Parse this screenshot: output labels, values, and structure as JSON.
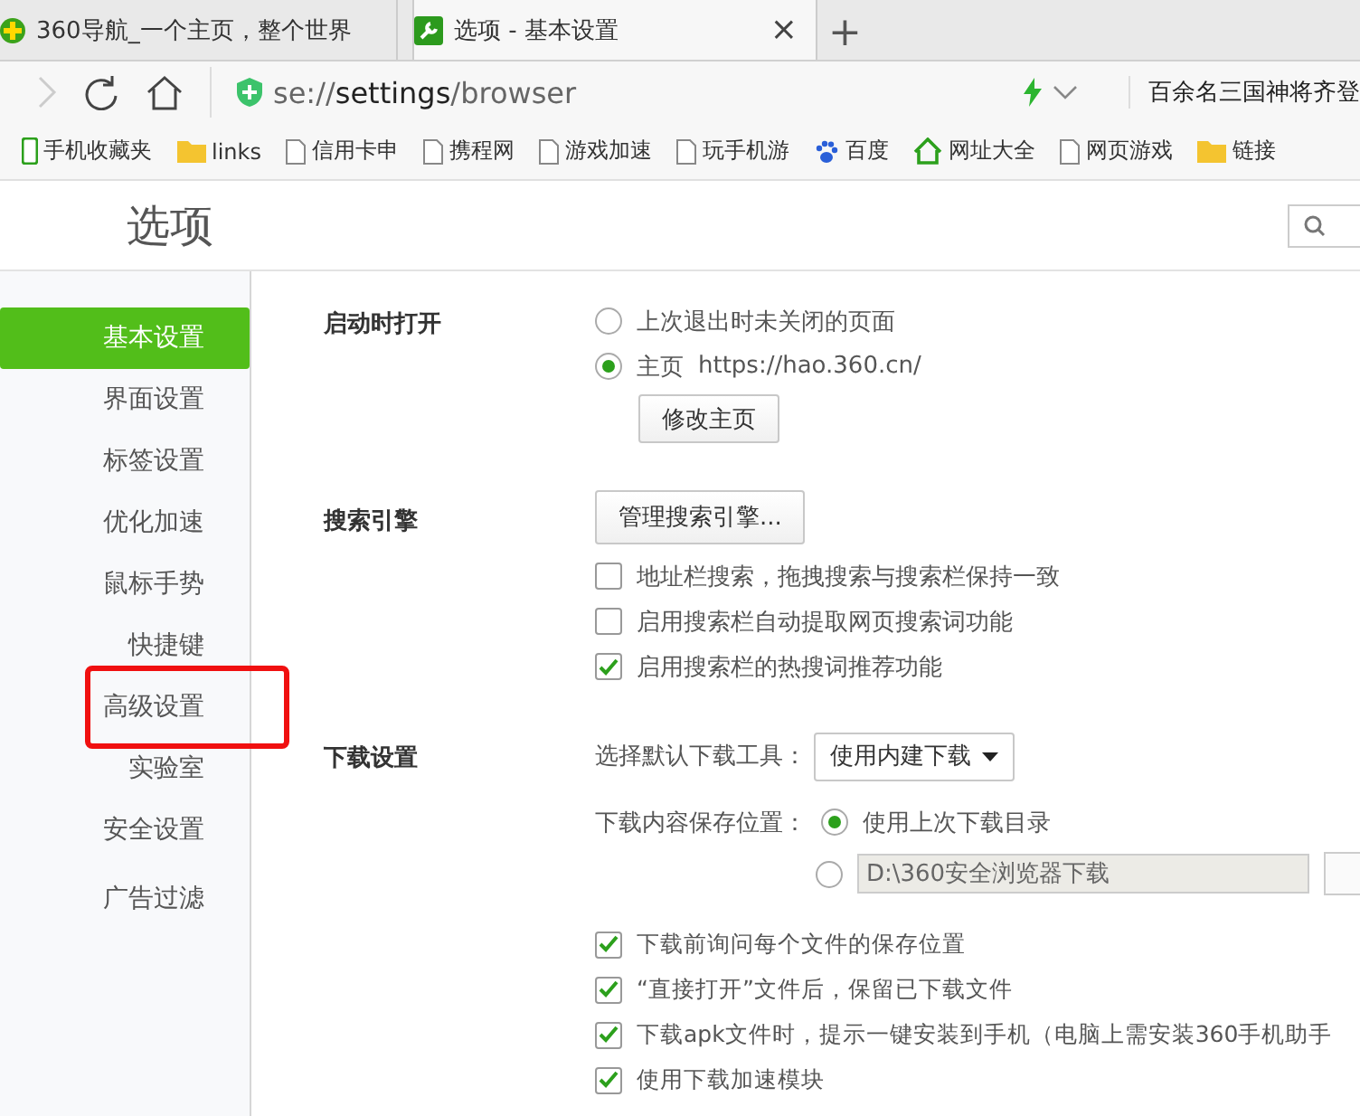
{
  "tabs": [
    {
      "title": "360导航_一个主页，整个世界",
      "selected": false,
      "kind": "plus"
    },
    {
      "title": "选项 - 基本设置",
      "selected": true,
      "kind": "wrench",
      "close": "×"
    }
  ],
  "new_tab": "+",
  "address": {
    "scheme": "se://",
    "host": "settings",
    "path": "/browser",
    "news": "百余名三国神将齐登"
  },
  "bookmarks": [
    {
      "label": "手机收藏夹",
      "kind": "phone"
    },
    {
      "label": "links",
      "kind": "folder"
    },
    {
      "label": "信用卡申",
      "kind": "page"
    },
    {
      "label": "携程网",
      "kind": "page"
    },
    {
      "label": "游戏加速",
      "kind": "page"
    },
    {
      "label": "玩手机游",
      "kind": "page"
    },
    {
      "label": "百度",
      "kind": "paw"
    },
    {
      "label": "网址大全",
      "kind": "house"
    },
    {
      "label": "网页游戏",
      "kind": "page"
    },
    {
      "label": "链接",
      "kind": "folder"
    }
  ],
  "page_title": "选项",
  "sidebar": [
    {
      "label": "基本设置",
      "selected": true,
      "highlighted": false
    },
    {
      "label": "界面设置",
      "selected": false,
      "highlighted": false
    },
    {
      "label": "标签设置",
      "selected": false,
      "highlighted": false
    },
    {
      "label": "优化加速",
      "selected": false,
      "highlighted": false
    },
    {
      "label": "鼠标手势",
      "selected": false,
      "highlighted": false
    },
    {
      "label": "快捷键",
      "selected": false,
      "highlighted": false
    },
    {
      "label": "高级设置",
      "selected": false,
      "highlighted": true
    },
    {
      "label": "实验室",
      "selected": false,
      "highlighted": false
    },
    {
      "label": "安全设置",
      "selected": false,
      "highlighted": false
    },
    {
      "label": "广告过滤",
      "selected": false,
      "highlighted": false
    }
  ],
  "startup": {
    "heading": "启动时打开",
    "options": [
      {
        "label": "上次退出时未关闭的页面",
        "selected": false
      },
      {
        "label": "主页",
        "url": "https://hao.360.cn/",
        "selected": true
      }
    ],
    "button": "修改主页"
  },
  "search": {
    "heading": "搜索引擎",
    "button": "管理搜索引擎...",
    "options": [
      {
        "label": "地址栏搜索，拖拽搜索与搜索栏保持一致",
        "checked": false
      },
      {
        "label": "启用搜索栏自动提取网页搜索词功能",
        "checked": false
      },
      {
        "label": "启用搜索栏的热搜词推荐功能",
        "checked": true
      }
    ]
  },
  "download": {
    "heading": "下载设置",
    "tool_label": "选择默认下载工具：",
    "tool_value": "使用内建下载",
    "location_label": "下载内容保存位置：",
    "locations": [
      {
        "label": "使用上次下载目录",
        "selected": true
      },
      {
        "path": "D:\\360安全浏览器下载",
        "selected": false
      }
    ],
    "options": [
      {
        "label": "下载前询问每个文件的保存位置",
        "checked": true
      },
      {
        "label": "“直接打开”文件后，保留已下载文件",
        "checked": true
      },
      {
        "label": "下载apk文件时，提示一键安装到手机（电脑上需安装360手机助手",
        "checked": true
      },
      {
        "label": "使用下载加速模块",
        "checked": true
      }
    ]
  }
}
